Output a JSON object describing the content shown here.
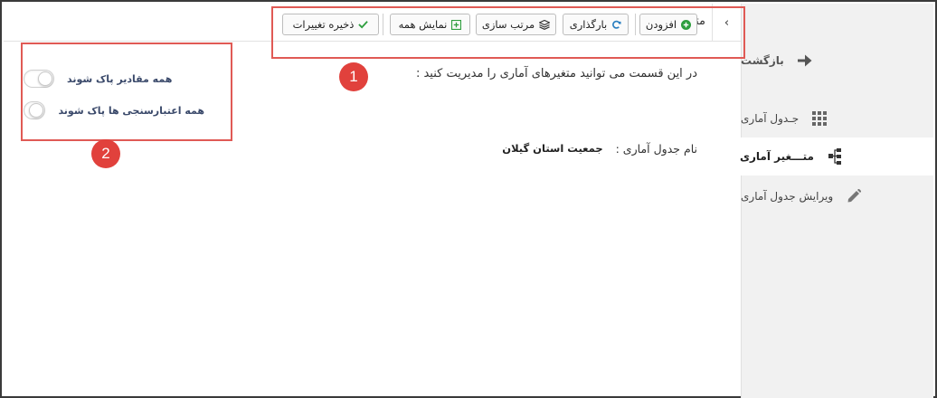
{
  "sidebar": {
    "back_label": "بازگشت",
    "items": [
      {
        "label": "جـدول آماری",
        "icon": "grid-icon"
      },
      {
        "label": "متـــغیر آماری",
        "icon": "hierarchy-icon",
        "active": true
      },
      {
        "label": "ویرایش جدول آماری",
        "icon": "pencil-icon"
      }
    ]
  },
  "toolbar": {
    "collapse_glyph": "‹",
    "label": "متغیر :",
    "add_label": "افزودن",
    "reload_label": "بارگذاری",
    "sort_label": "مرتب سازی",
    "show_all_label": "نمایش همه",
    "save_label": "ذخیره تغییرات"
  },
  "main": {
    "intro": "در این قسمت می توانید متغیرهای آماری را مدیریت کنید :",
    "table_name_label": "نام جدول آماری :",
    "table_name_value": "جمعیت استان گیلان"
  },
  "toggles": [
    {
      "label": "همه مقادیر پاک شوند",
      "on": false
    },
    {
      "label": "همه اعتبارسنجی ها پاک شوند",
      "on": false
    }
  ],
  "annotations": [
    {
      "number": "1"
    },
    {
      "number": "2"
    }
  ],
  "colors": {
    "annotation": "#e1413c",
    "add_icon": "#2e9e3e",
    "reload_icon": "#2a7fc0",
    "show_all_icon": "#2e9e3e",
    "save_icon": "#2e9e3e"
  }
}
